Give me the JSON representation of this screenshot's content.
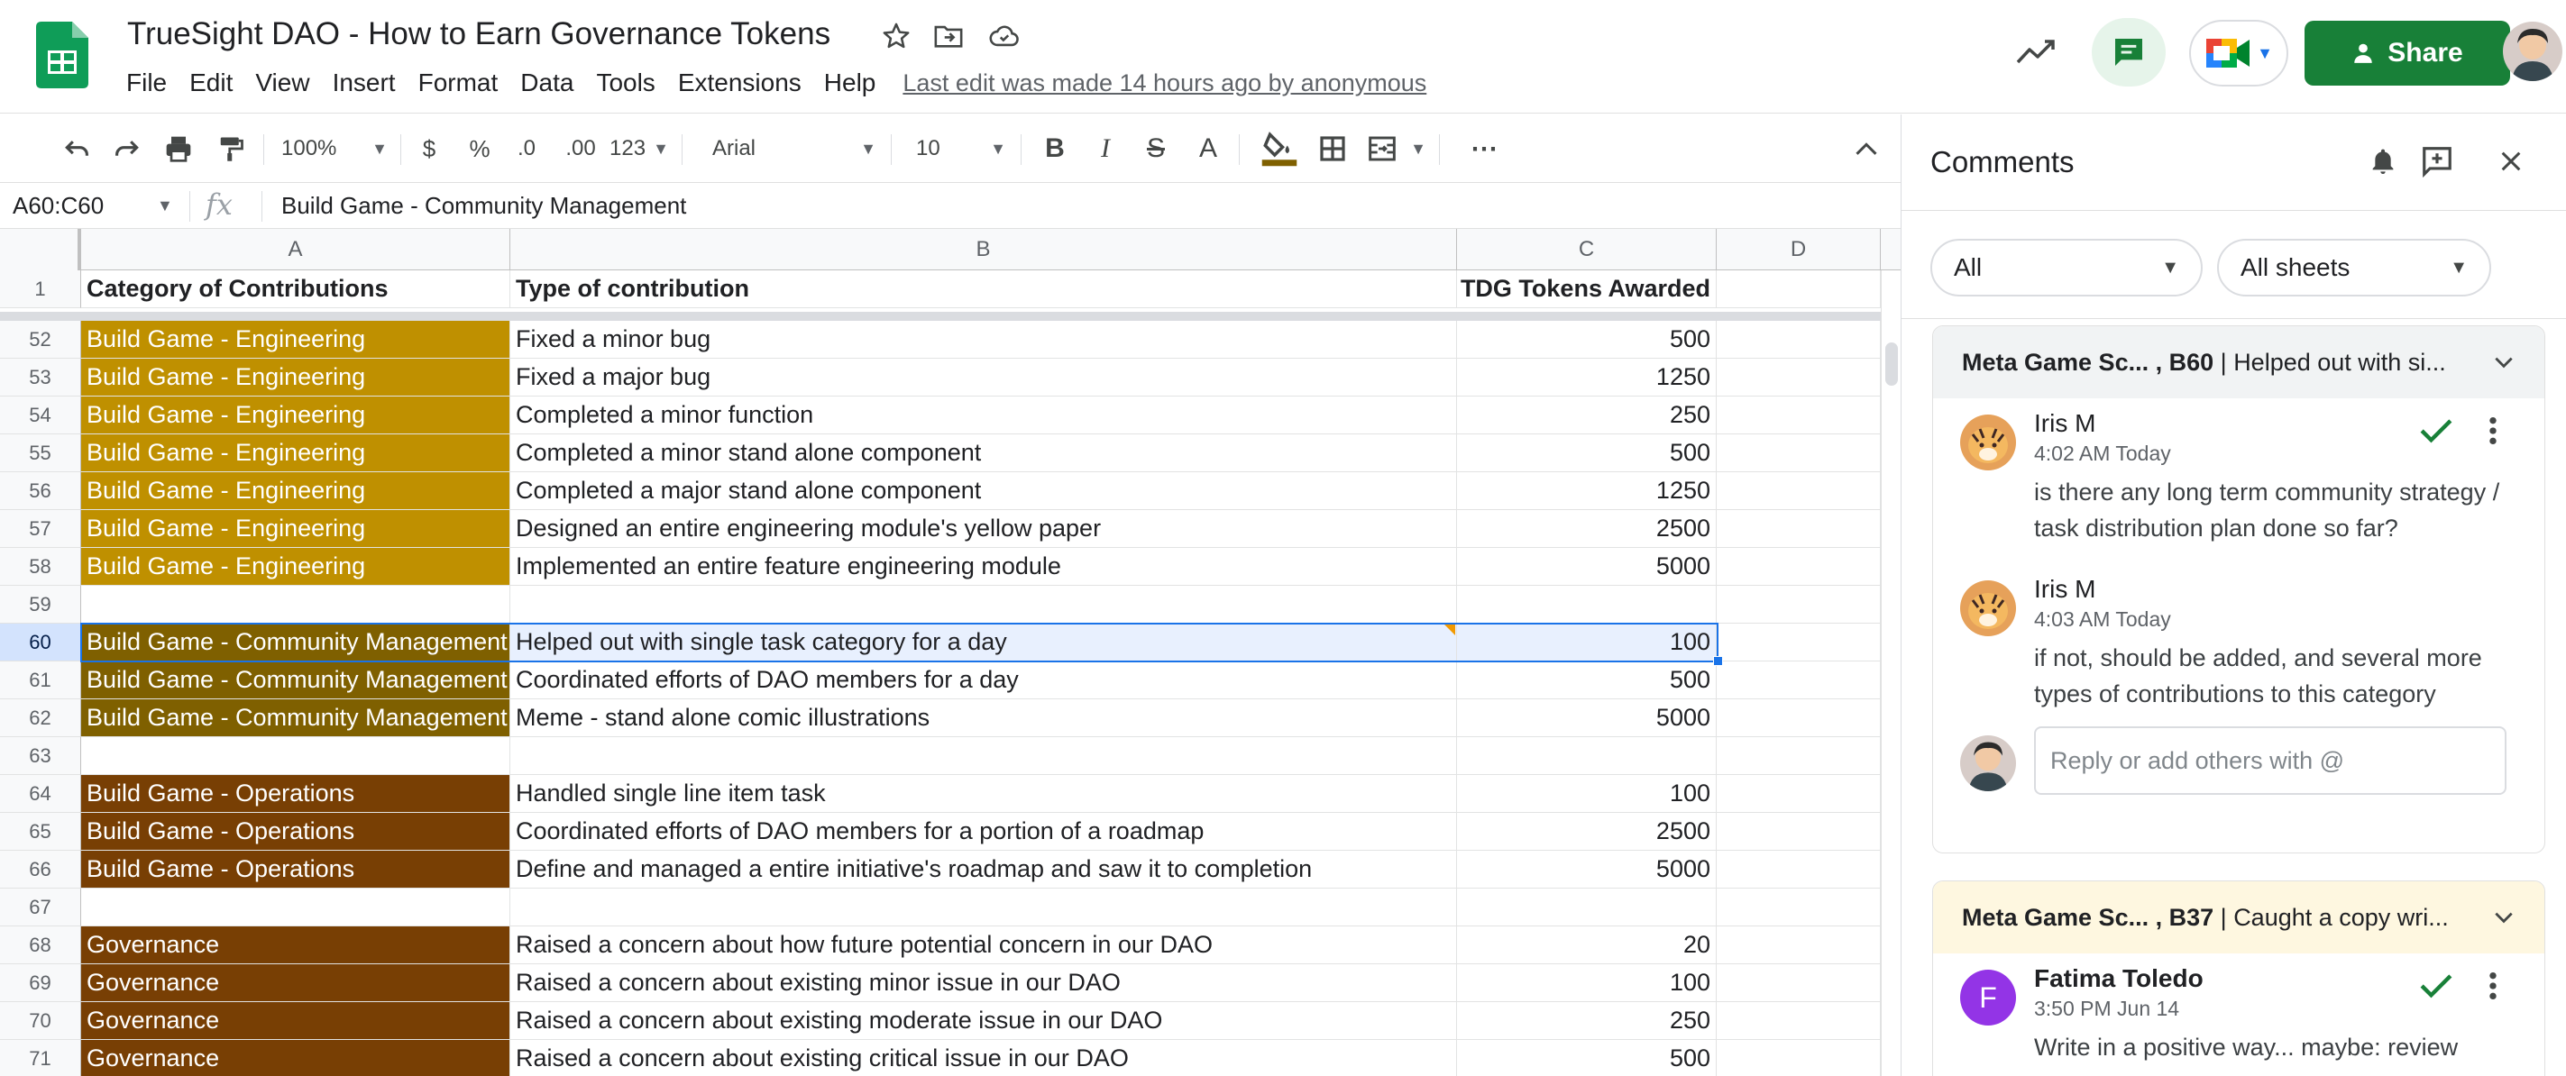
{
  "app": {
    "doc_title": "TrueSight DAO - How to Earn Governance Tokens",
    "menu": [
      "File",
      "Edit",
      "View",
      "Insert",
      "Format",
      "Data",
      "Tools",
      "Extensions",
      "Help"
    ],
    "last_edit": "Last edit was made 14 hours ago by anonymous",
    "share_label": "Share",
    "brand_color": "#0F9D58",
    "share_color": "#188038"
  },
  "toolbar": {
    "zoom": "100%",
    "currency": "$",
    "percent": "%",
    "dec_decrease": ".0",
    "dec_increase": ".00",
    "more_formats": "123",
    "font": "Arial",
    "font_size": "10",
    "bold": "B",
    "italic": "I",
    "strike": "S",
    "text_color": "A",
    "more": "⋯"
  },
  "formula_bar": {
    "name_box": "A60:C60",
    "fx": "fx",
    "value": "Build Game - Community Management"
  },
  "grid": {
    "columns": [
      "A",
      "B",
      "C",
      "D"
    ],
    "header_row": {
      "num": "1",
      "a": "Category of Contributions",
      "b": "Type of contribution",
      "c": "TDG Tokens Awarded"
    },
    "rows": [
      {
        "num": "52",
        "a": "Build Game - Engineering",
        "b": "Fixed a minor bug",
        "c": "500",
        "fill": "#bf9000",
        "fg": "#ffffff"
      },
      {
        "num": "53",
        "a": "Build Game - Engineering",
        "b": "Fixed a major bug",
        "c": "1250",
        "fill": "#bf9000",
        "fg": "#ffffff"
      },
      {
        "num": "54",
        "a": "Build Game - Engineering",
        "b": "Completed a minor function",
        "c": "250",
        "fill": "#bf9000",
        "fg": "#ffffff"
      },
      {
        "num": "55",
        "a": "Build Game - Engineering",
        "b": "Completed a minor stand alone component",
        "c": "500",
        "fill": "#bf9000",
        "fg": "#ffffff"
      },
      {
        "num": "56",
        "a": "Build Game - Engineering",
        "b": "Completed a major stand alone component",
        "c": "1250",
        "fill": "#bf9000",
        "fg": "#ffffff"
      },
      {
        "num": "57",
        "a": "Build Game - Engineering",
        "b": "Designed an entire engineering module's yellow paper",
        "c": "2500",
        "fill": "#bf9000",
        "fg": "#ffffff"
      },
      {
        "num": "58",
        "a": "Build Game - Engineering",
        "b": "Implemented an entire feature engineering module",
        "c": "5000",
        "fill": "#bf9000",
        "fg": "#ffffff"
      },
      {
        "num": "59",
        "a": "",
        "b": "",
        "c": "",
        "fill": "",
        "fg": ""
      },
      {
        "num": "60",
        "a": "Build Game - Community Management",
        "b": "Helped out with single task category for a day",
        "c": "100",
        "fill": "#7f6000",
        "fg": "#ffffff",
        "selected": true
      },
      {
        "num": "61",
        "a": "Build Game - Community Management",
        "b": "Coordinated efforts of DAO members for a day",
        "c": "500",
        "fill": "#7f6000",
        "fg": "#ffffff"
      },
      {
        "num": "62",
        "a": "Build Game - Community Management",
        "b": "Meme - stand alone comic illustrations",
        "c": "5000",
        "fill": "#7f6000",
        "fg": "#ffffff"
      },
      {
        "num": "63",
        "a": "",
        "b": "",
        "c": "",
        "fill": "",
        "fg": ""
      },
      {
        "num": "64",
        "a": "Build Game - Operations",
        "b": "Handled single line item task",
        "c": "100",
        "fill": "#783f04",
        "fg": "#ffffff"
      },
      {
        "num": "65",
        "a": "Build Game - Operations",
        "b": "Coordinated efforts of DAO members for a portion of a roadmap",
        "c": "2500",
        "fill": "#783f04",
        "fg": "#ffffff"
      },
      {
        "num": "66",
        "a": "Build Game - Operations",
        "b": "Define and managed a entire initiative's roadmap and saw it to completion",
        "c": "5000",
        "fill": "#783f04",
        "fg": "#ffffff"
      },
      {
        "num": "67",
        "a": "",
        "b": "",
        "c": "",
        "fill": "",
        "fg": ""
      },
      {
        "num": "68",
        "a": "Governance",
        "b": "Raised a concern about how future potential concern in our DAO",
        "c": "20",
        "fill": "#783f04",
        "fg": "#ffffff"
      },
      {
        "num": "69",
        "a": "Governance",
        "b": "Raised a concern about existing minor issue in our DAO",
        "c": "100",
        "fill": "#783f04",
        "fg": "#ffffff"
      },
      {
        "num": "70",
        "a": "Governance",
        "b": "Raised a concern about existing moderate issue in our DAO",
        "c": "250",
        "fill": "#783f04",
        "fg": "#ffffff"
      },
      {
        "num": "71",
        "a": "Governance",
        "b": "Raised a concern about existing critical issue in our DAO",
        "c": "500",
        "fill": "#783f04",
        "fg": "#ffffff"
      }
    ],
    "selection_color": "#1a73e8"
  },
  "comments": {
    "title": "Comments",
    "filter_all": "All",
    "filter_sheets": "All sheets",
    "threads": [
      {
        "ref_sheet": "Meta Game Sc... ,",
        "ref_cell": "B60",
        "ref_sep": "|",
        "ref_text": "Helped out with si...",
        "comments": [
          {
            "author": "Iris M",
            "time": "4:02 AM Today",
            "text": "is there any long term community strategy / task distribution plan done so far?"
          },
          {
            "author": "Iris M",
            "time": "4:03 AM Today",
            "text": "if not, should be added, and several more types of contributions to this category"
          }
        ],
        "reply_placeholder": "Reply or add others with @"
      },
      {
        "ref_sheet": "Meta Game Sc... ,",
        "ref_cell": "B37",
        "ref_sep": "|",
        "ref_text": "Caught a copy wri...",
        "comments": [
          {
            "author": "Fatima Toledo",
            "avatar_letter": "F",
            "time": "3:50 PM Jun 14",
            "text": "Write in a positive way... maybe: review"
          }
        ]
      }
    ],
    "resolve_color": "#188038",
    "avatar_f_color": "#9334e6"
  }
}
